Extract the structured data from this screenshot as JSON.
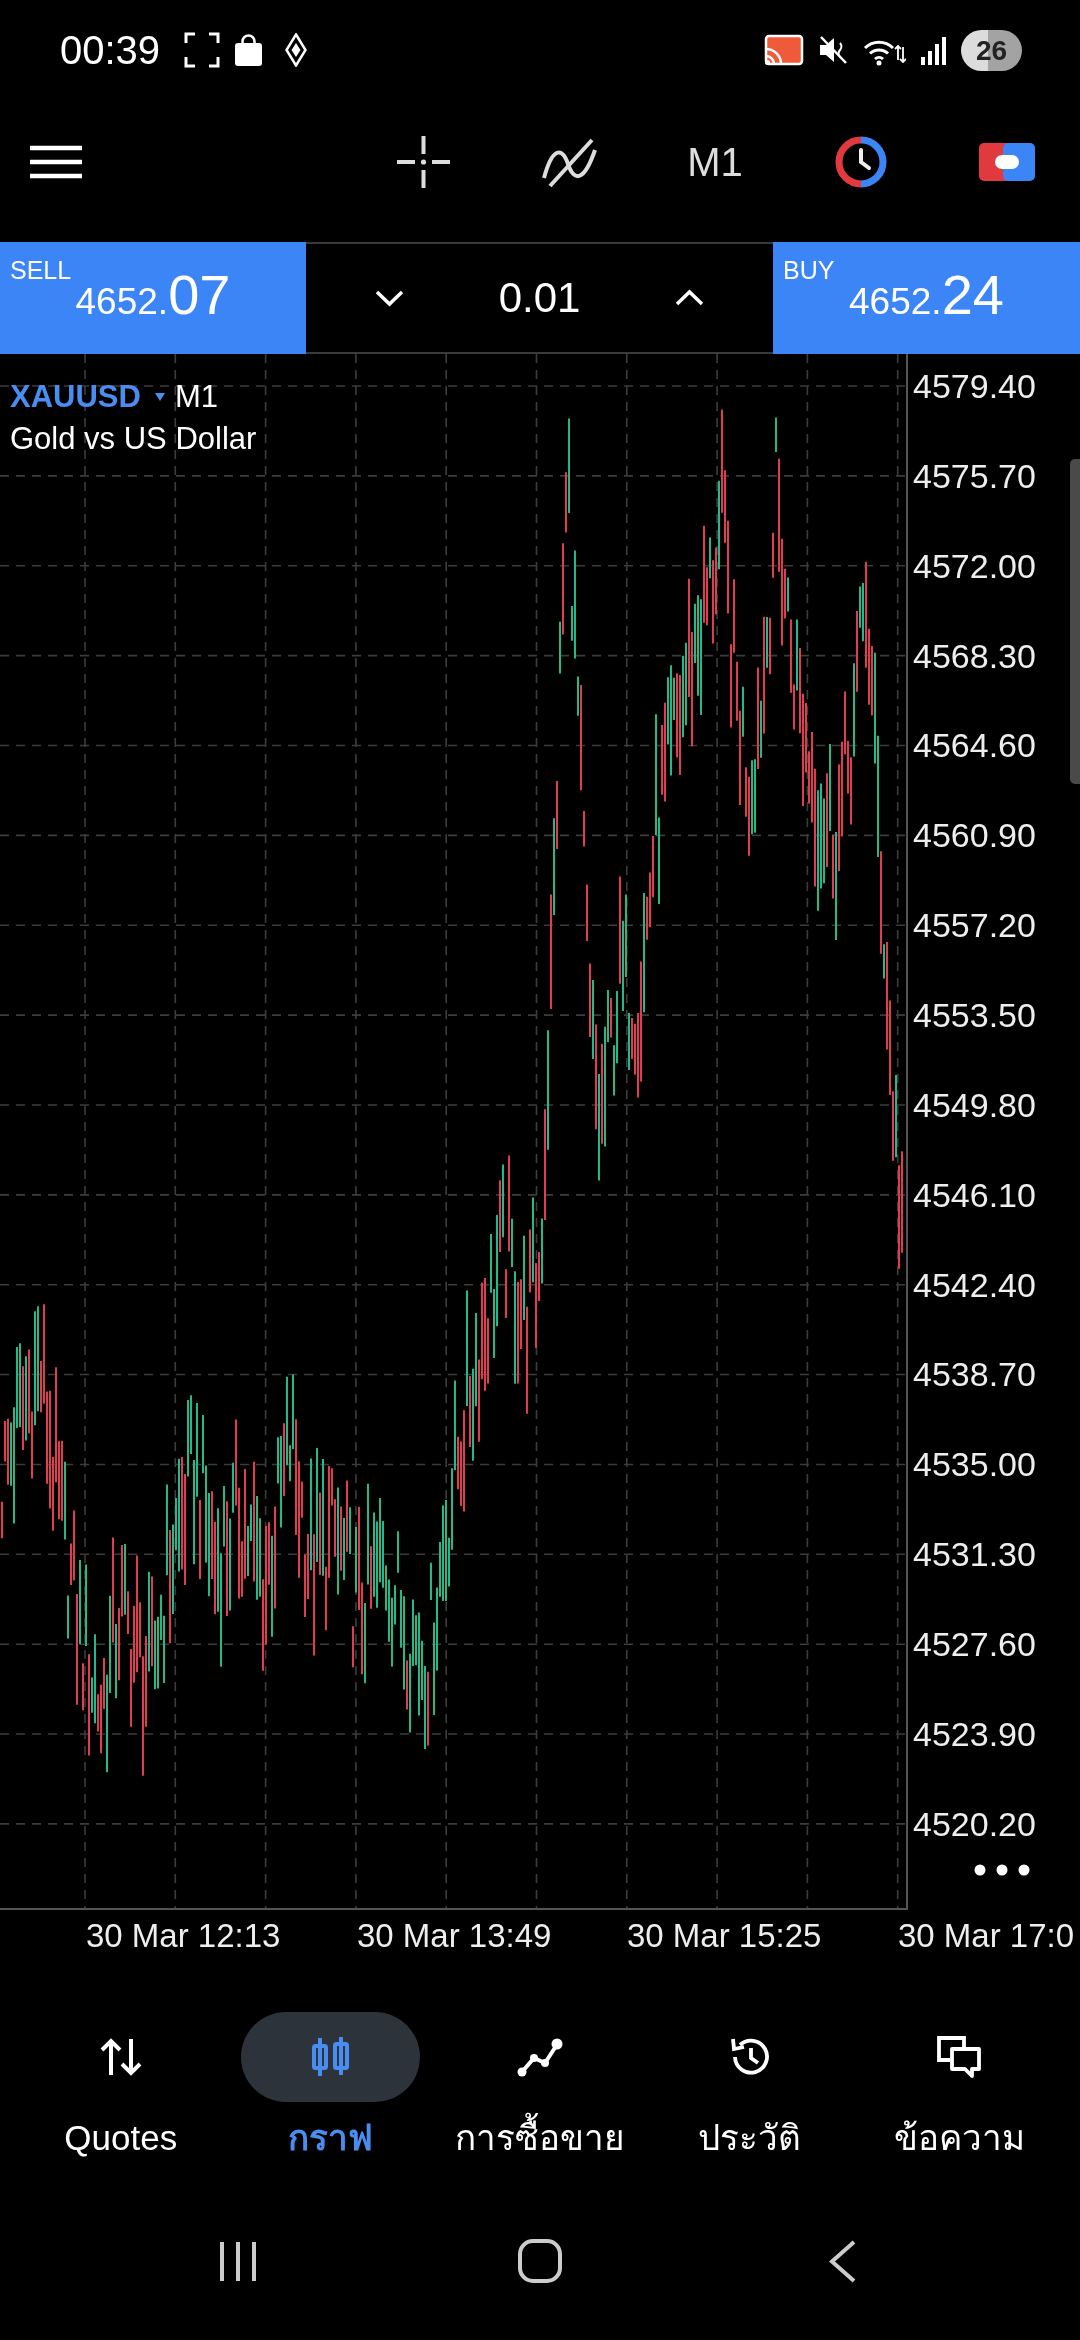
{
  "status_bar": {
    "time": "00:39",
    "battery": "26"
  },
  "toolbar": {
    "timeframe": "M1"
  },
  "trade_panel": {
    "sell": {
      "label": "SELL",
      "price_main": "4652.",
      "price_pips": "07"
    },
    "volume": "0.01",
    "buy": {
      "label": "BUY",
      "price_main": "4652.",
      "price_pips": "24"
    }
  },
  "chart": {
    "symbol": "XAUUSD",
    "timeframe": "M1",
    "description": "Gold vs US Dollar",
    "price_labels": [
      "4579.40",
      "4575.70",
      "4572.00",
      "4568.30",
      "4564.60",
      "4560.90",
      "4557.20",
      "4553.50",
      "4549.80",
      "4546.10",
      "4542.40",
      "4538.70",
      "4535.00",
      "4531.30",
      "4527.60",
      "4523.90",
      "4520.20"
    ],
    "time_labels": [
      "30 Mar 12:13",
      "30 Mar 13:49",
      "30 Mar 15:25",
      "30 Mar 17:0"
    ]
  },
  "bottom_nav": {
    "items": [
      {
        "label": "Quotes",
        "selected": false
      },
      {
        "label": "กราฟ",
        "selected": true
      },
      {
        "label": "การซื้อขาย",
        "selected": false
      },
      {
        "label": "ประวัติ",
        "selected": false
      },
      {
        "label": "ข้อความ",
        "selected": false
      }
    ]
  }
}
